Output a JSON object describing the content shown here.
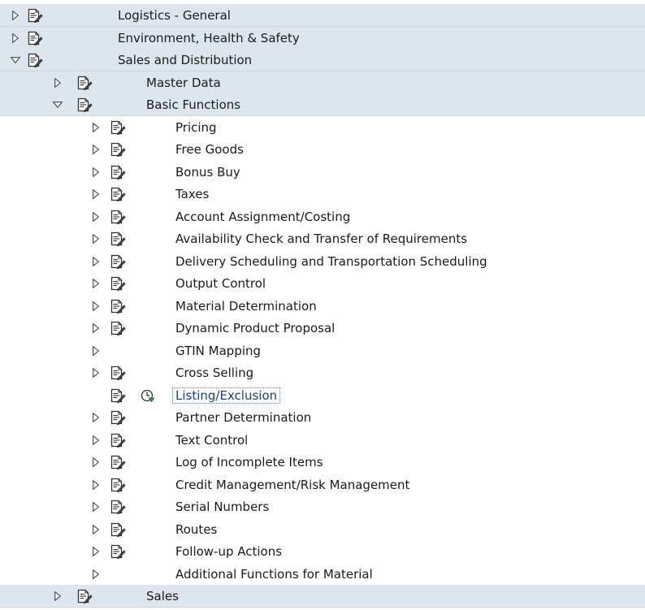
{
  "tree": [
    {
      "label": "Logistics - General",
      "level": 0,
      "expander": "collapsed",
      "has_icon": true
    },
    {
      "label": "Environment, Health & Safety",
      "level": 0,
      "expander": "collapsed",
      "has_icon": true
    },
    {
      "label": "Sales and Distribution",
      "level": 0,
      "expander": "expanded",
      "has_icon": true
    },
    {
      "label": "Master Data",
      "level": 1,
      "expander": "collapsed",
      "has_icon": true
    },
    {
      "label": "Basic Functions",
      "level": 1,
      "expander": "expanded",
      "has_icon": true
    },
    {
      "label": "Pricing",
      "level": 2,
      "expander": "collapsed",
      "has_icon": true
    },
    {
      "label": "Free Goods",
      "level": 2,
      "expander": "collapsed",
      "has_icon": true
    },
    {
      "label": "Bonus Buy",
      "level": 2,
      "expander": "collapsed",
      "has_icon": true
    },
    {
      "label": "Taxes",
      "level": 2,
      "expander": "collapsed",
      "has_icon": true
    },
    {
      "label": "Account Assignment/Costing",
      "level": 2,
      "expander": "collapsed",
      "has_icon": true
    },
    {
      "label": "Availability Check and Transfer of Requirements",
      "level": 2,
      "expander": "collapsed",
      "has_icon": true
    },
    {
      "label": "Delivery Scheduling and Transportation Scheduling",
      "level": 2,
      "expander": "collapsed",
      "has_icon": true
    },
    {
      "label": "Output Control",
      "level": 2,
      "expander": "collapsed",
      "has_icon": true
    },
    {
      "label": "Material Determination",
      "level": 2,
      "expander": "collapsed",
      "has_icon": true
    },
    {
      "label": "Dynamic Product Proposal",
      "level": 2,
      "expander": "collapsed",
      "has_icon": true
    },
    {
      "label": "GTIN Mapping",
      "level": 2,
      "expander": "collapsed",
      "has_icon": false
    },
    {
      "label": "Cross Selling",
      "level": 2,
      "expander": "collapsed",
      "has_icon": true
    },
    {
      "label": "Listing/Exclusion",
      "level": 2,
      "expander": "none",
      "has_icon": true,
      "execute_icon": true,
      "selected": true
    },
    {
      "label": "Partner Determination",
      "level": 2,
      "expander": "collapsed",
      "has_icon": true
    },
    {
      "label": "Text Control",
      "level": 2,
      "expander": "collapsed",
      "has_icon": true
    },
    {
      "label": "Log of Incomplete Items",
      "level": 2,
      "expander": "collapsed",
      "has_icon": true
    },
    {
      "label": "Credit Management/Risk Management",
      "level": 2,
      "expander": "collapsed",
      "has_icon": true
    },
    {
      "label": "Serial Numbers",
      "level": 2,
      "expander": "collapsed",
      "has_icon": true
    },
    {
      "label": "Routes",
      "level": 2,
      "expander": "collapsed",
      "has_icon": true
    },
    {
      "label": "Follow-up Actions",
      "level": 2,
      "expander": "collapsed",
      "has_icon": true
    },
    {
      "label": "Additional Functions for Material",
      "level": 2,
      "expander": "collapsed",
      "has_icon": false
    },
    {
      "label": "Sales",
      "level": 1,
      "expander": "collapsed",
      "has_icon": true
    }
  ],
  "icons": {
    "node": "documentation-icon",
    "execute": "clock-execute-icon",
    "collapsed": "expand-triangle-icon",
    "expanded": "collapse-triangle-icon"
  },
  "colors": {
    "band": "#dde6ef",
    "selected_text": "#17408b",
    "icon_lines": "#333333"
  }
}
